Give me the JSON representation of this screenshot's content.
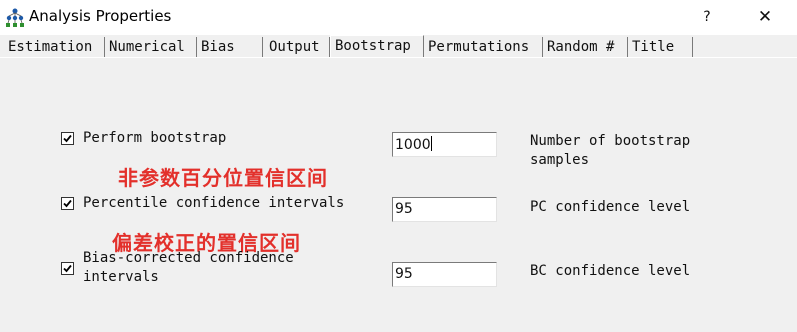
{
  "window": {
    "title": "Analysis Properties",
    "help_label": "?",
    "close_label": "✕"
  },
  "tabs": [
    {
      "label": "Estimation"
    },
    {
      "label": "Numerical"
    },
    {
      "label": "Bias"
    },
    {
      "label": "Output"
    },
    {
      "label": "Bootstrap",
      "active": true
    },
    {
      "label": "Permutations"
    },
    {
      "label": "Random #"
    },
    {
      "label": "Title"
    }
  ],
  "bootstrap": {
    "perform": {
      "label": "Perform bootstrap",
      "checked": true,
      "value": "1000",
      "desc": "Number of bootstrap\nsamples"
    },
    "percentile": {
      "label": "Percentile confidence intervals",
      "checked": true,
      "value": "95",
      "desc": "PC confidence level"
    },
    "bias_corrected": {
      "label": "Bias-corrected confidence\nintervals",
      "checked": true,
      "value": "95",
      "desc": "BC confidence level"
    }
  },
  "annotations": {
    "percentile_note": "非参数百分位置信区间",
    "bias_note": "偏差校正的置信区间"
  },
  "colors": {
    "annotation": "#e3302b",
    "background": "#f0f0f0"
  }
}
